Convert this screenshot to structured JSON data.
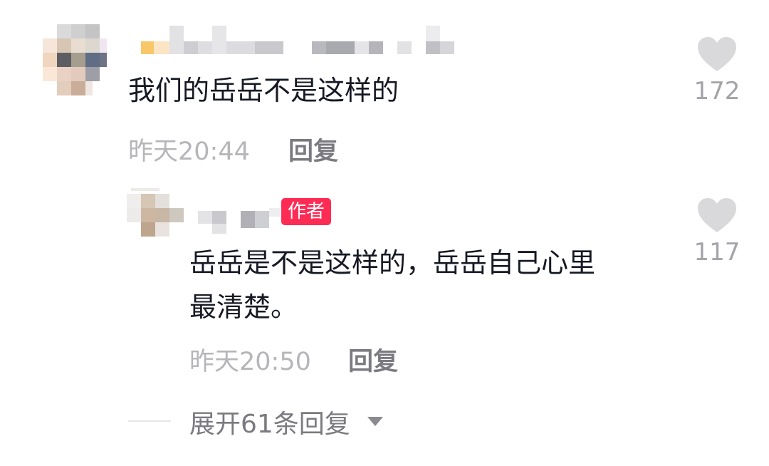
{
  "comment": {
    "text": "我们的岳岳不是这样的",
    "time": "昨天20:44",
    "reply_label": "回复",
    "like_count": "172"
  },
  "reply": {
    "badge": "作者",
    "text": "岳岳是不是这样的，岳岳自己心里\n最清楚。",
    "time": "昨天20:50",
    "reply_label": "回复",
    "like_count": "117"
  },
  "expand": {
    "label": "展开61条回复"
  },
  "icons": {
    "like": "heart-icon",
    "expand": "caret-down-icon"
  },
  "colors": {
    "author_badge": "#fe2c55",
    "text": "#161823",
    "muted": "#b6b6ba"
  }
}
